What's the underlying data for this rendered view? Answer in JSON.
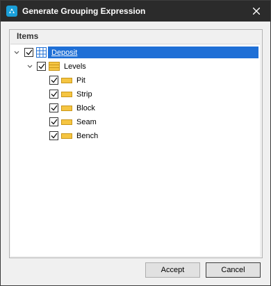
{
  "window": {
    "title": "Generate Grouping Expression"
  },
  "groupbox": {
    "label": "Items"
  },
  "tree": {
    "root": {
      "label": "Deposit",
      "checked": true,
      "expanded": true,
      "selected": true
    },
    "levels": {
      "label": "Levels",
      "checked": true,
      "expanded": true
    },
    "items": [
      {
        "label": "Pit",
        "checked": true
      },
      {
        "label": "Strip",
        "checked": true
      },
      {
        "label": "Block",
        "checked": true
      },
      {
        "label": "Seam",
        "checked": true
      },
      {
        "label": "Bench",
        "checked": true
      }
    ]
  },
  "buttons": {
    "accept": "Accept",
    "cancel": "Cancel"
  },
  "colors": {
    "titlebar": "#2b2b2b",
    "selection": "#1e6fd6",
    "folder": "#f5c542"
  }
}
